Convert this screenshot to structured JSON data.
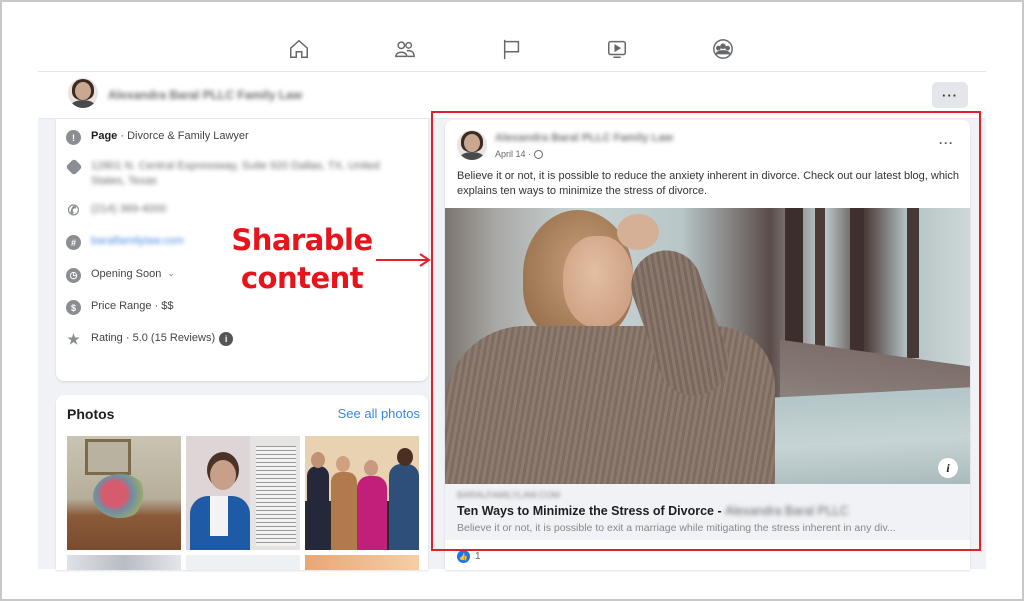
{
  "top_nav": {
    "items": [
      {
        "name": "home",
        "icon": "home-icon"
      },
      {
        "name": "friends",
        "icon": "friends-icon"
      },
      {
        "name": "pages",
        "icon": "flag-icon"
      },
      {
        "name": "watch",
        "icon": "video-icon"
      },
      {
        "name": "groups",
        "icon": "groups-icon"
      }
    ]
  },
  "profile_bar": {
    "page_name": "Alexandra Baral PLLC Family Law",
    "more_label": "···"
  },
  "intro": {
    "rows": [
      {
        "icon": "info-icon",
        "label_bold": "Page",
        "label": " · Divorce & Family Lawyer"
      },
      {
        "icon": "directions-icon",
        "label": "12801 N. Central Expressway, Suite 920 Dallas, TX, United States, Texas",
        "blurred": true
      },
      {
        "icon": "phone-icon",
        "label": "(214) 369-4000",
        "blurred": true
      },
      {
        "icon": "website-icon",
        "label": "baralfamilylaw.com",
        "blurred": true
      },
      {
        "icon": "clock-icon",
        "label": "Opening Soon",
        "has_dropdown": true
      },
      {
        "icon": "price-icon",
        "label": "Price Range · $$"
      },
      {
        "icon": "star-icon",
        "label": "Rating · 5.0 (15 Reviews)",
        "has_info": true
      }
    ]
  },
  "photos": {
    "title": "Photos",
    "see_all_label": "See all photos"
  },
  "post": {
    "author": "Alexandra Baral PLLC Family Law",
    "date": "April 14 ·",
    "more_label": "···",
    "text": "Believe it or not, it is possible to reduce the anxiety inherent in divorce. Check out our latest blog, which explains ten ways to minimize the stress of divorce.",
    "link_preview": {
      "domain": "BARALFAMILYLAW.COM",
      "title": "Ten Ways to Minimize the Stress of Divorce - ",
      "title_suffix": "Alexandra Baral PLLC",
      "description": "Believe it or not, it is possible to exit a marriage while mitigating the stress inherent in any div..."
    },
    "info_label": "i",
    "reaction_count": "1"
  },
  "annotation": {
    "label_line1": "Sharable",
    "label_line2": "content",
    "color": "#e0202a"
  }
}
